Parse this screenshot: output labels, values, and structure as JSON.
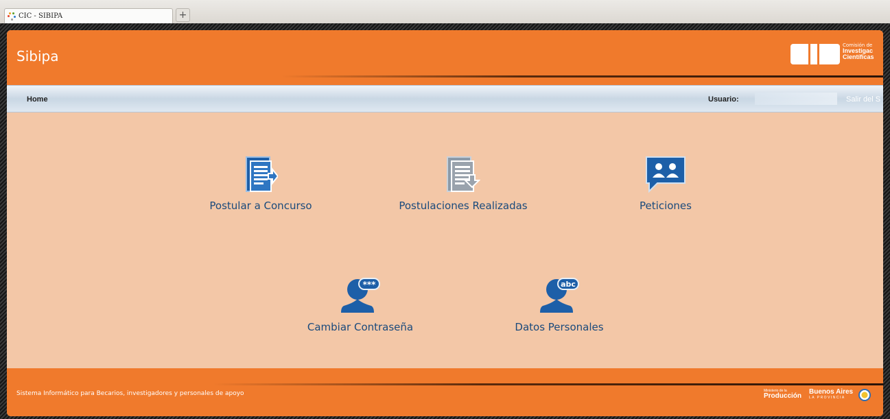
{
  "browser": {
    "tab_title": "CIC - SIBIPA",
    "new_tab_label": "+"
  },
  "header": {
    "app_title": "Sibipa",
    "logo": {
      "mark": "CIC",
      "line1": "Comisión de",
      "line2": "Investigac",
      "line3": "Científicas"
    }
  },
  "nav": {
    "home_label": "Home",
    "user_label": "Usuario:",
    "user_value": "",
    "logout_label": "Salir del S"
  },
  "menu": {
    "items": [
      {
        "label": "Postular a Concurso",
        "icon": "document-arrow-icon"
      },
      {
        "label": "Postulaciones Realizadas",
        "icon": "documents-download-icon"
      },
      {
        "label": "Peticiones",
        "icon": "chat-people-icon"
      },
      {
        "label": "Cambiar Contraseña",
        "icon": "user-password-icon",
        "badge": "***"
      },
      {
        "label": "Datos Personales",
        "icon": "user-abc-icon",
        "badge": "abc"
      }
    ]
  },
  "footer": {
    "note": "Sistema Informático para Becarios, investigadores y personales de apoyo",
    "sponsor1_small": "Ministerio de la",
    "sponsor1": "Producción",
    "sponsor2": "Buenos Aires",
    "sponsor2_small": "LA PROVINCIA"
  },
  "colors": {
    "brand_orange": "#f07a2c",
    "page_bg": "#f3c7a7",
    "link_blue": "#1a4a7c",
    "icon_blue": "#1d5fa8"
  }
}
